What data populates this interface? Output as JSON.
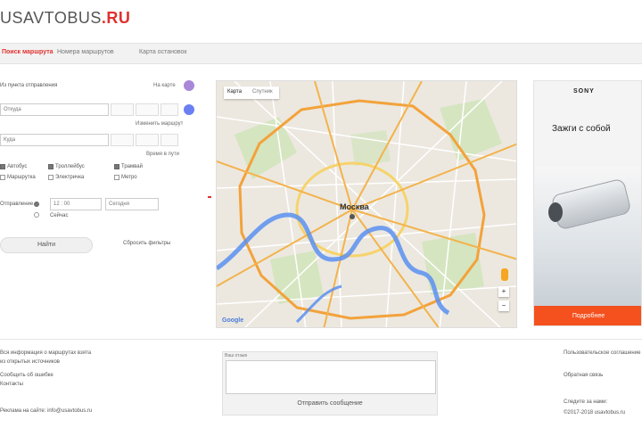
{
  "header": {
    "logo_text": "USAVTOBUS",
    "logo_tld": ".RU"
  },
  "nav": {
    "tabs": [
      {
        "label": "Поиск маршрута",
        "active": true
      },
      {
        "label": "Номера маршрутов",
        "active": false
      },
      {
        "label": "Карта остановок",
        "active": false
      }
    ]
  },
  "form": {
    "from_label": "Из пункта отправления",
    "from_pick_link": "На карте",
    "from_value": "Откуда",
    "to_value": "Куда",
    "other_route_link": "Изменить маршрут",
    "to_time_link": "Время в пути",
    "transport_types": [
      {
        "label": "Автобус",
        "checked": true
      },
      {
        "label": "Троллейбус",
        "checked": true
      },
      {
        "label": "Трамвай",
        "checked": true
      },
      {
        "label": "Маршрутка",
        "checked": false
      },
      {
        "label": "Электричка",
        "checked": false
      },
      {
        "label": "Метро",
        "checked": false
      }
    ],
    "time_label": "Отправление",
    "time_now_label": "Сейчас",
    "time_hour_value": "12 : 00",
    "time_date_value": "Сегодня",
    "search_button": "Найти",
    "clear_link": "Сбросить фильтры",
    "colors": {
      "from_marker": "#a987d9",
      "to_marker": "#6a7ff2"
    }
  },
  "map": {
    "type_buttons": [
      "Карта",
      "Спутник"
    ],
    "city_label": "Москва",
    "zoom_in": "+",
    "zoom_out": "−",
    "attribution": "Google",
    "colors": {
      "ring_road": "#f3a23b",
      "river": "#5b8ff0",
      "green": "#cfe3b8"
    }
  },
  "ad": {
    "brand": "SONY",
    "slogan": "Зажги с собой",
    "cta": "Подробнее",
    "colors": {
      "cta_bg": "#f4511e"
    }
  },
  "footer": {
    "left_lines": [
      "Вся информация о маршрутах взята",
      "из открытых источников",
      "Сообщить об ошибке",
      "Контакты",
      "Реклама на сайте: info@usavtobus.ru"
    ],
    "feedback": {
      "label": "Ваш отзыв",
      "placeholder": "",
      "send_button": "Отправить сообщение"
    },
    "right_lines": [
      "Пользовательское соглашение",
      "Обратная связь",
      "Следите за нами:",
      "©2017-2018 usavtobus.ru"
    ]
  }
}
